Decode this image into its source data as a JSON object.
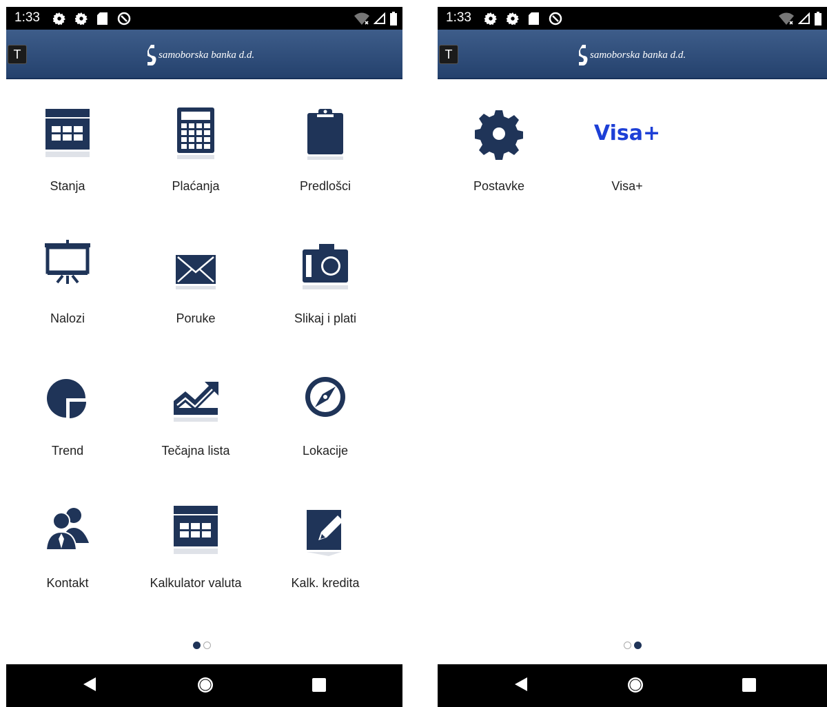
{
  "status_bar": {
    "time": "1:33"
  },
  "header": {
    "bank_name": "samoborska banka d.d.",
    "t_button": "T"
  },
  "page1": {
    "tiles": [
      {
        "label": "Stanja",
        "icon": "calendar-icon"
      },
      {
        "label": "Plaćanja",
        "icon": "calculator-icon"
      },
      {
        "label": "Predlošci",
        "icon": "clipboard-icon"
      },
      {
        "label": "Nalozi",
        "icon": "presentation-board-icon"
      },
      {
        "label": "Poruke",
        "icon": "envelope-icon"
      },
      {
        "label": "Slikaj i plati",
        "icon": "camera-icon"
      },
      {
        "label": "Trend",
        "icon": "pie-chart-icon"
      },
      {
        "label": "Tečajna lista",
        "icon": "trend-chart-icon"
      },
      {
        "label": "Lokacije",
        "icon": "compass-icon"
      },
      {
        "label": "Kontakt",
        "icon": "people-icon"
      },
      {
        "label": "Kalkulator valuta",
        "icon": "calendar-icon"
      },
      {
        "label": "Kalk. kredita",
        "icon": "pencil-note-icon"
      }
    ],
    "current_page": 1,
    "total_pages": 2
  },
  "page2": {
    "tiles": [
      {
        "label": "Postavke",
        "icon": "gear-icon"
      },
      {
        "label": "Visa+",
        "icon": "visa-plus-logo",
        "logo_text": "Visa+"
      }
    ],
    "current_page": 2,
    "total_pages": 2
  },
  "colors": {
    "header": "#2c4a77",
    "icon": "#1f3458",
    "visa": "#1d3fd6"
  }
}
